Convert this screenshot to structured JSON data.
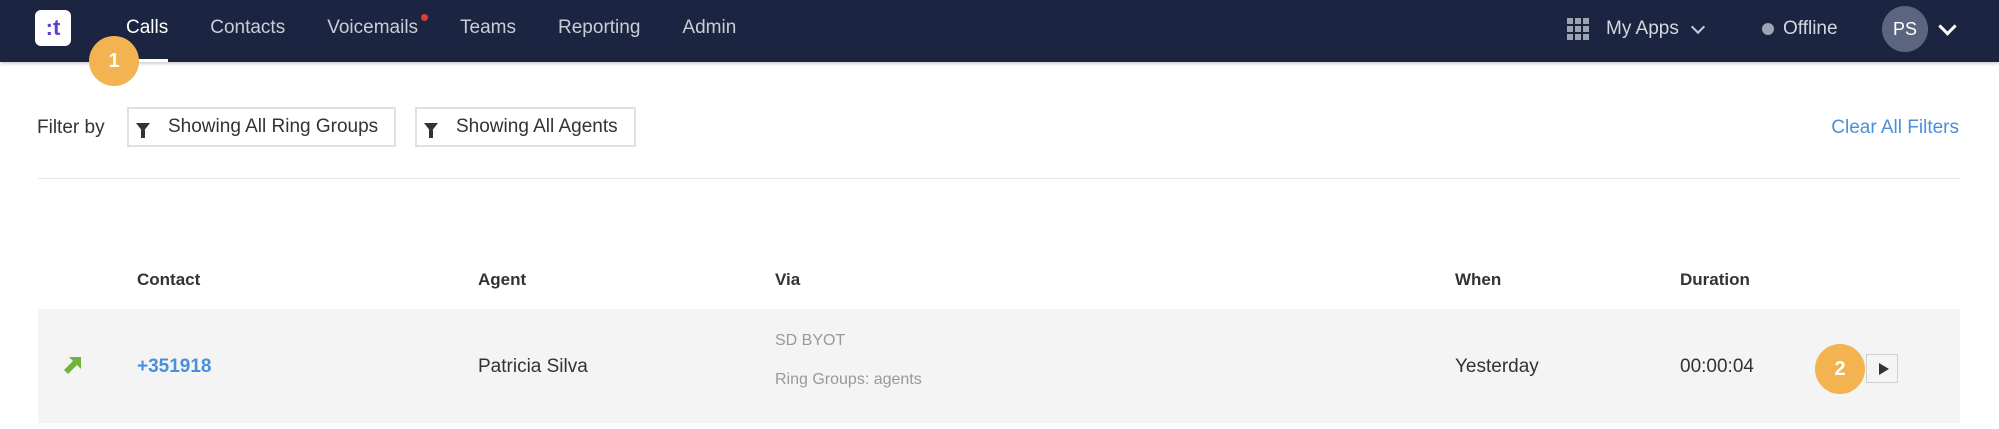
{
  "app": {
    "logo_text": ":t",
    "brand_color": "#1b2440",
    "accent_color": "#5b3fd6"
  },
  "nav": {
    "items": [
      {
        "label": "Calls",
        "active": true
      },
      {
        "label": "Contacts",
        "active": false
      },
      {
        "label": "Voicemails",
        "active": false,
        "notification": true
      },
      {
        "label": "Teams",
        "active": false
      },
      {
        "label": "Reporting",
        "active": false
      },
      {
        "label": "Admin",
        "active": false
      }
    ]
  },
  "header_right": {
    "apps_label": "My Apps",
    "apps_icon": "grid-icon",
    "status_label": "Offline",
    "status_color": "#9ea3b3",
    "avatar_initials": "PS"
  },
  "annotations": {
    "badge_1": "1",
    "badge_2": "2",
    "badge_color": "#f2b350"
  },
  "filters": {
    "label": "Filter by",
    "ring_groups": "Showing All Ring Groups",
    "agents": "Showing All Agents",
    "clear": "Clear All Filters",
    "icon": "funnel-icon"
  },
  "table": {
    "headers": [
      "Contact",
      "Agent",
      "Via",
      "When",
      "Duration"
    ],
    "rows": [
      {
        "direction_icon": "outbound-arrow-icon",
        "direction_color": "#6fb33d",
        "contact": "+351918",
        "agent": "Patricia Silva",
        "via_line1": "SD BYOT",
        "via_line2": "Ring Groups: agents",
        "when": "Yesterday",
        "duration": "00:00:04",
        "action_icon": "play-icon"
      }
    ]
  }
}
